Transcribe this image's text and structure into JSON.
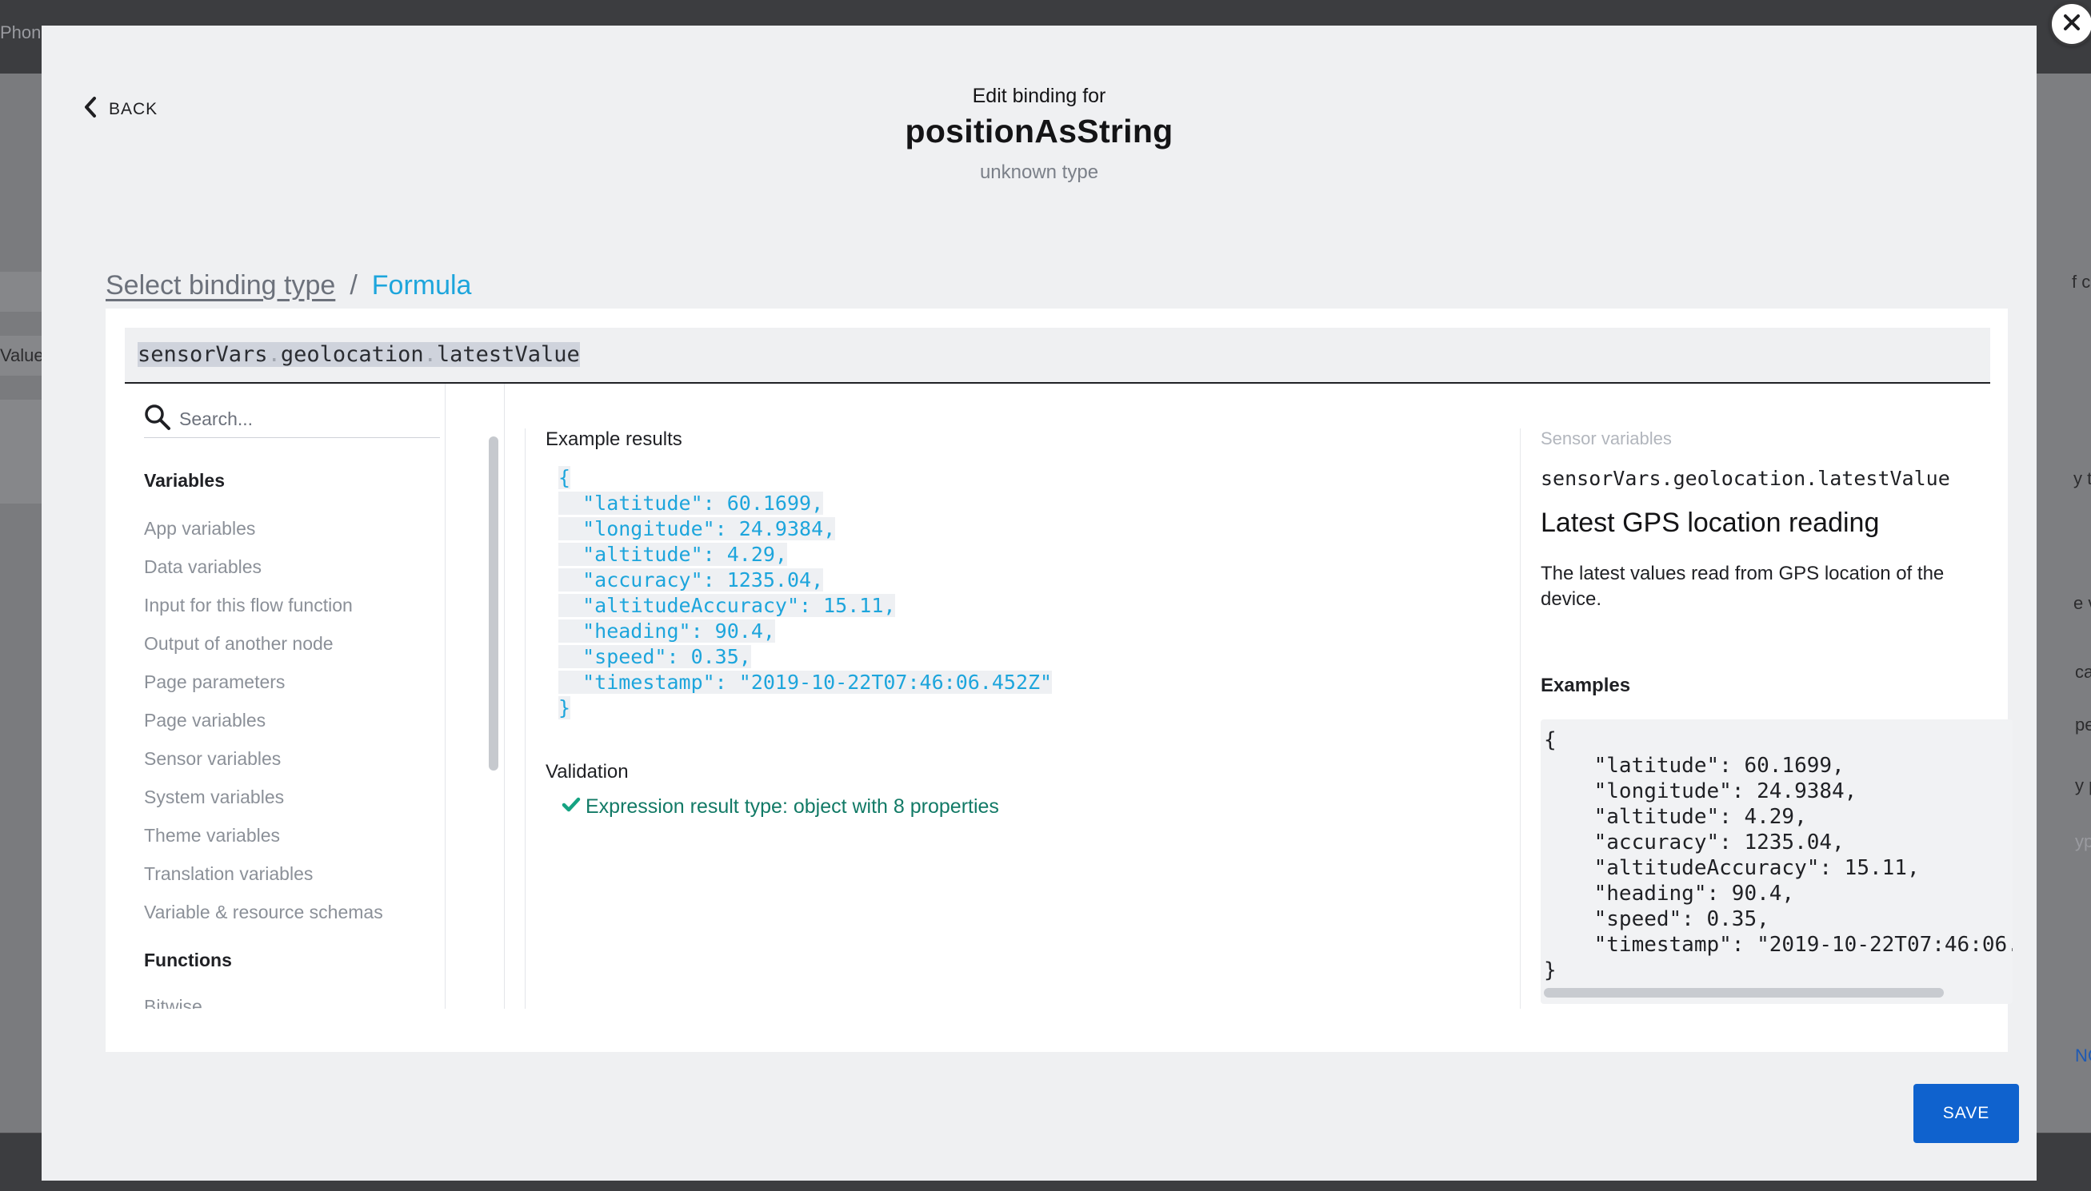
{
  "background": {
    "left_fragments": [
      "Phon",
      "Value"
    ],
    "right_fragments": [
      "f c",
      "y t",
      "e v",
      "car",
      "per",
      "y p",
      "ype",
      "NC"
    ]
  },
  "modal": {
    "back_label": "BACK",
    "header_sub": "Edit binding for",
    "header_title": "positionAsString",
    "header_type": "unknown type"
  },
  "breadcrumb": {
    "link": "Select binding type",
    "separator": "/",
    "current": "Formula"
  },
  "formula": {
    "part1": "sensorVars",
    "dot1": ".",
    "part2": "geolocation",
    "dot2": ".",
    "part3": "latestValue"
  },
  "sidebar": {
    "search_placeholder": "Search...",
    "variables_title": "Variables",
    "items": [
      "App variables",
      "Data variables",
      "Input for this flow function",
      "Output of another node",
      "Page parameters",
      "Page variables",
      "Sensor variables",
      "System variables",
      "Theme variables",
      "Translation variables",
      "Variable & resource schemas"
    ],
    "functions_title": "Functions",
    "partial_item": "Bitwise"
  },
  "results": {
    "label": "Example results",
    "json_lines": [
      "{",
      "  \"latitude\": 60.1699,",
      "  \"longitude\": 24.9384,",
      "  \"altitude\": 4.29,",
      "  \"accuracy\": 1235.04,",
      "  \"altitudeAccuracy\": 15.11,",
      "  \"heading\": 90.4,",
      "  \"speed\": 0.35,",
      "  \"timestamp\": \"2019-10-22T07:46:06.452Z\"",
      "}"
    ],
    "validation_label": "Validation",
    "validation_message": "Expression result type: object with 8 properties"
  },
  "info": {
    "category": "Sensor variables",
    "expression": "sensorVars.geolocation.latestValue",
    "title": "Latest GPS location reading",
    "description": "The latest values read from GPS location of the device.",
    "examples_title": "Examples",
    "example_lines": [
      "{",
      "    \"latitude\": 60.1699,",
      "    \"longitude\": 24.9384,",
      "    \"altitude\": 4.29,",
      "    \"accuracy\": 1235.04,",
      "    \"altitudeAccuracy\": 15.11,",
      "    \"heading\": 90.4,",
      "    \"speed\": 0.35,",
      "    \"timestamp\": \"2019-10-22T07:46:06.",
      "}"
    ]
  },
  "actions": {
    "save_label": "SAVE"
  },
  "colors": {
    "accent": "#1da5dc",
    "primary_button": "#0f62ce",
    "valid": "#127a66"
  }
}
